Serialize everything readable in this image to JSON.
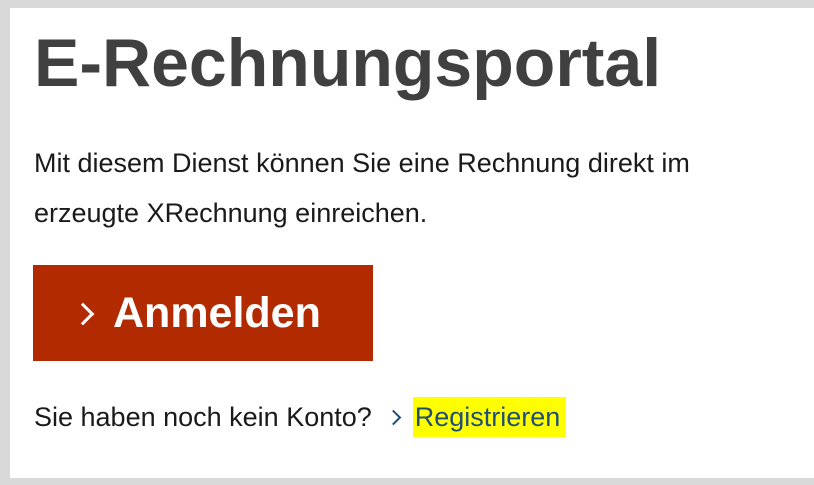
{
  "page": {
    "title": "E-Rechnungsportal",
    "description_lines": [
      "Mit diesem Dienst können Sie eine Rechnung direkt im",
      "erzeugte XRechnung einreichen."
    ]
  },
  "login_button": {
    "label": "Anmelden",
    "icon": "chevron-right-icon",
    "background": "#b22a00",
    "text_color": "#ffffff"
  },
  "register": {
    "prompt": "Sie haben noch kein Konto?",
    "link_label": "Registrieren",
    "icon": "chevron-right-icon",
    "highlight_color": "#ffff00",
    "link_color": "#1f4e79"
  }
}
